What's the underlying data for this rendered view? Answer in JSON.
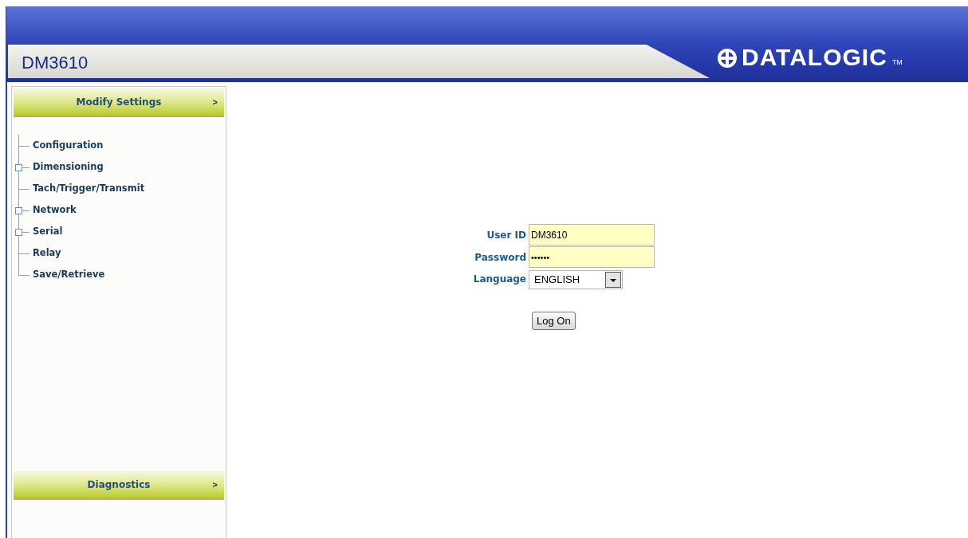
{
  "header": {
    "title": "DM3610",
    "logo_text": "DATALOGIC",
    "logo_mark": "TM"
  },
  "sidebar": {
    "sections": [
      {
        "label": "Modify Settings",
        "arrow": ">"
      },
      {
        "label": "Diagnostics",
        "arrow": ">"
      }
    ],
    "tree": [
      {
        "label": "Configuration",
        "kind": "leaf"
      },
      {
        "label": "Dimensioning",
        "kind": "branch"
      },
      {
        "label": "Tach/Trigger/Transmit",
        "kind": "leaf"
      },
      {
        "label": "Network",
        "kind": "branch"
      },
      {
        "label": "Serial",
        "kind": "branch"
      },
      {
        "label": "Relay",
        "kind": "leaf"
      },
      {
        "label": "Save/Retrieve",
        "kind": "leaf"
      }
    ]
  },
  "login": {
    "user_id_label": "User ID",
    "user_id": "DM3610",
    "password_label": "Password",
    "password": "••••••",
    "language_label": "Language",
    "language": "ENGLISH",
    "button": "Log On"
  }
}
